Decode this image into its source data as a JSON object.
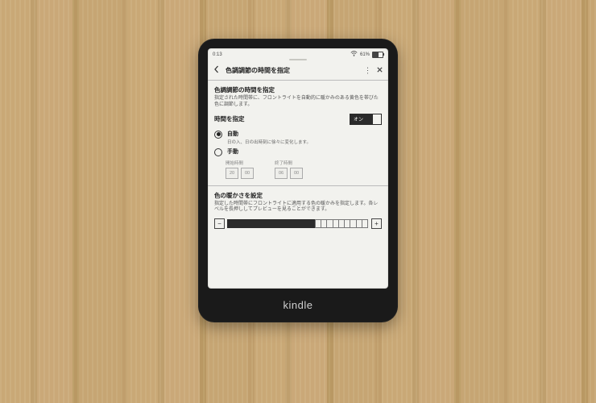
{
  "device_brand": "kindle",
  "status": {
    "time": "0:13",
    "battery_pct": "61%"
  },
  "header": {
    "title": "色調調節の時間を指定"
  },
  "section1": {
    "heading": "色調調節の時間を指定",
    "desc": "指定された時間帯に、フロントライトを自動的に暖かみのある黄色を帯びた色に調節します。"
  },
  "schedule": {
    "label": "時間を指定",
    "toggle_label": "オン",
    "auto": {
      "label": "自動",
      "sub": "日の入、日の出時刻に徐々に変化します。"
    },
    "manual": {
      "label": "手動",
      "start_cap": "開始時間",
      "end_cap": "終了時間",
      "start_h": "20",
      "start_m": "00",
      "end_h": "06",
      "end_m": "00"
    }
  },
  "warmth": {
    "heading": "色の暖かさを設定",
    "desc": "指定した時間帯にフロントライトに適用する色の暖かみを指定します。各レベルを長押ししてプレビューを見ることができます。",
    "level": 15,
    "max": 24
  }
}
